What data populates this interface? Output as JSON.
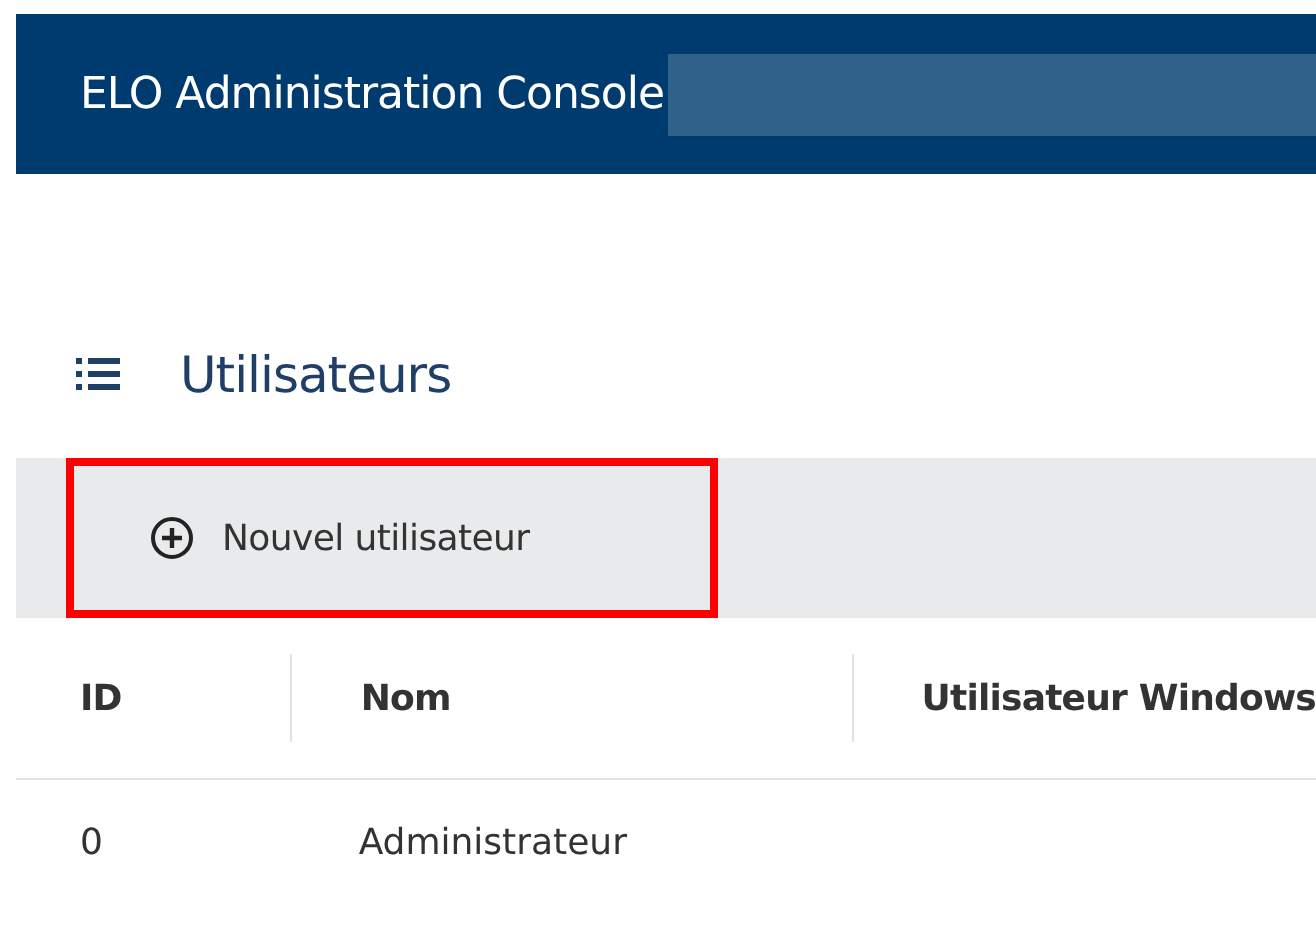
{
  "window": {
    "title": "ELO Administration Console"
  },
  "page": {
    "title": "Utilisateurs"
  },
  "toolbar": {
    "buttons": [
      {
        "label": "Nouvel utilisateur",
        "highlighted": true
      }
    ]
  },
  "table": {
    "columns": [
      "ID",
      "Nom",
      "Utilisateur Windows"
    ],
    "rows": [
      [
        "0",
        "Administrateur",
        ""
      ]
    ]
  }
}
